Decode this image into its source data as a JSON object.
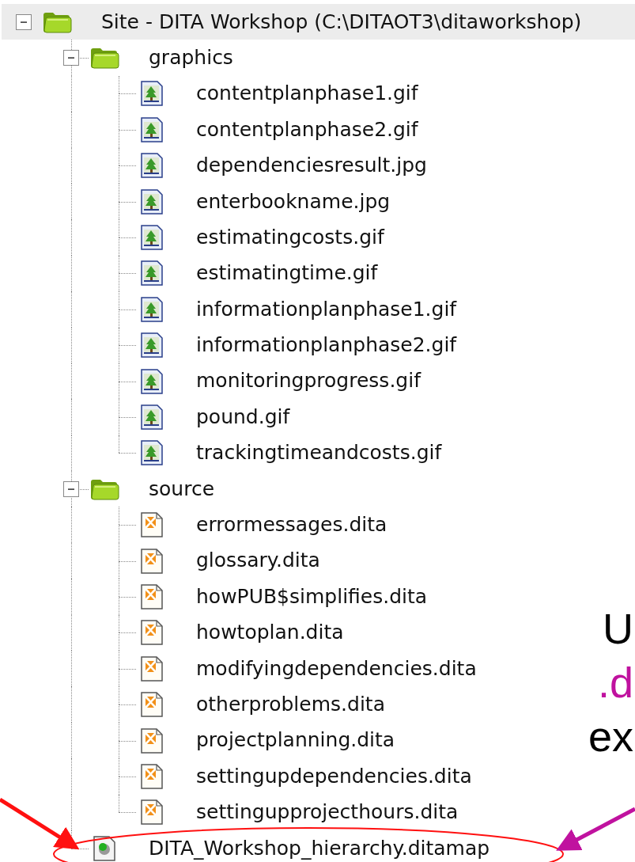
{
  "tree": {
    "items": [
      {
        "label": "Site - DITA Workshop (C:\\DITAOT3\\ditaworkshop)",
        "kind": "folder",
        "expanded": true,
        "selected": true,
        "children": [
          {
            "label": "graphics",
            "kind": "folder",
            "expanded": true,
            "selected": false,
            "children": [
              {
                "label": "contentplanphase1.gif",
                "kind": "image",
                "selected": false
              },
              {
                "label": "contentplanphase2.gif",
                "kind": "image",
                "selected": false
              },
              {
                "label": "dependenciesresult.jpg",
                "kind": "image",
                "selected": false
              },
              {
                "label": "enterbookname.jpg",
                "kind": "image",
                "selected": false
              },
              {
                "label": "estimatingcosts.gif",
                "kind": "image",
                "selected": false
              },
              {
                "label": "estimatingtime.gif",
                "kind": "image",
                "selected": false
              },
              {
                "label": "informationplanphase1.gif",
                "kind": "image",
                "selected": false
              },
              {
                "label": "informationplanphase2.gif",
                "kind": "image",
                "selected": false
              },
              {
                "label": "monitoringprogress.gif",
                "kind": "image",
                "selected": false
              },
              {
                "label": "pound.gif",
                "kind": "image",
                "selected": false
              },
              {
                "label": "trackingtimeandcosts.gif",
                "kind": "image",
                "selected": false
              }
            ]
          },
          {
            "label": "source",
            "kind": "folder",
            "expanded": true,
            "selected": false,
            "children": [
              {
                "label": "errormessages.dita",
                "kind": "dita",
                "selected": false
              },
              {
                "label": "glossary.dita",
                "kind": "dita",
                "selected": false
              },
              {
                "label": "howPUB$simplifies.dita",
                "kind": "dita",
                "selected": false
              },
              {
                "label": "howtoplan.dita",
                "kind": "dita",
                "selected": false
              },
              {
                "label": "modifyingdependencies.dita",
                "kind": "dita",
                "selected": false
              },
              {
                "label": "otherproblems.dita",
                "kind": "dita",
                "selected": false
              },
              {
                "label": "projectplanning.dita",
                "kind": "dita",
                "selected": false
              },
              {
                "label": "settingupdependencies.dita",
                "kind": "dita",
                "selected": false
              },
              {
                "label": "settingupprojecthours.dita",
                "kind": "dita",
                "selected": false
              }
            ]
          },
          {
            "label": "DITA_Workshop_hierarchy.ditamap",
            "kind": "ditamap",
            "selected": false
          }
        ]
      }
    ]
  },
  "annotation": {
    "lines": [
      {
        "text": "U",
        "color": "#000000"
      },
      {
        "text": ".d",
        "color": "#c0129f"
      },
      {
        "text": "ex",
        "color": "#000000"
      }
    ]
  }
}
